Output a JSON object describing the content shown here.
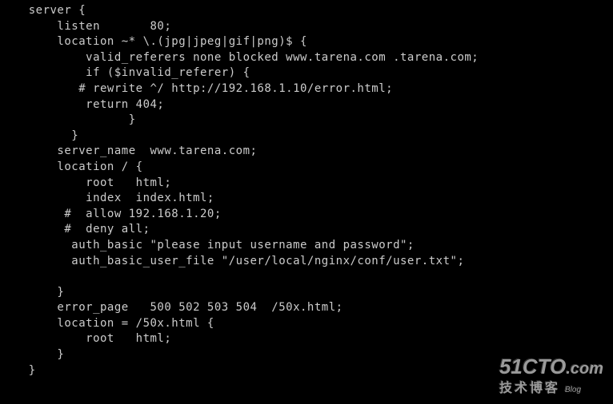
{
  "code": {
    "l01": "    server {",
    "l02": "        listen       80;",
    "l03": "        location ~* \\.(jpg|jpeg|gif|png)$ {",
    "l04": "            valid_referers none blocked www.tarena.com .tarena.com;",
    "l05": "            if ($invalid_referer) {",
    "l06": "           # rewrite ^/ http://192.168.1.10/error.html;",
    "l07": "            return 404;",
    "l08": "                  }",
    "l09": "          }",
    "l10": "        server_name  www.tarena.com;",
    "l11": "        location / {",
    "l12": "            root   html;",
    "l13": "            index  index.html;",
    "l14": "         #  allow 192.168.1.20;",
    "l15": "         #  deny all;",
    "l16": "          auth_basic \"please input username and password\";",
    "l17": "          auth_basic_user_file \"/user/local/nginx/conf/user.txt\";",
    "l18": "",
    "l19": "        }",
    "l20": "        error_page   500 502 503 504  /50x.html;",
    "l21": "        location = /50x.html {",
    "l22": "            root   html;",
    "l23": "        }",
    "l24": "    }"
  },
  "watermark": {
    "main": "51CTO",
    "dot": ".com",
    "sub": "技术博客",
    "blog": "Blog"
  }
}
